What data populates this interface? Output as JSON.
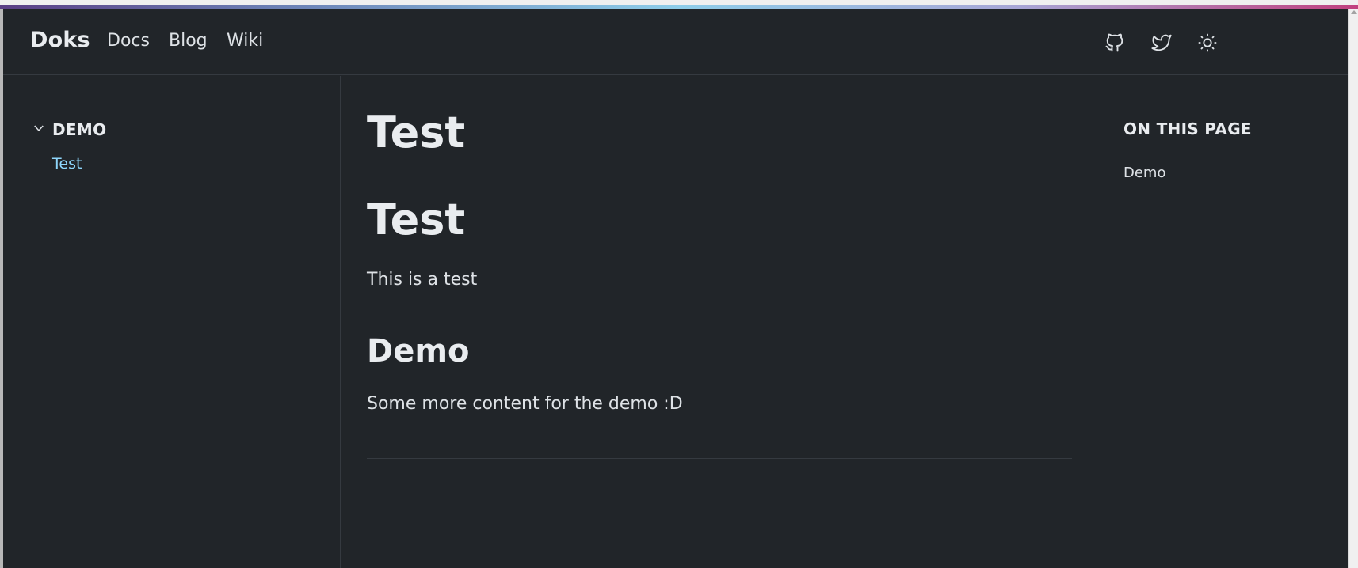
{
  "navbar": {
    "brand": "Doks",
    "links": [
      "Docs",
      "Blog",
      "Wiki"
    ],
    "icons": [
      "github-icon",
      "twitter-icon",
      "sun-icon"
    ]
  },
  "sidebar": {
    "section_title": "DEMO",
    "items": [
      "Test"
    ]
  },
  "content": {
    "title": "Test",
    "heading": "Test",
    "paragraph1": "This is a test",
    "subheading": "Demo",
    "paragraph2": "Some more content for the demo :D"
  },
  "toc": {
    "title": "ON THIS PAGE",
    "items": [
      "Demo"
    ]
  },
  "colors": {
    "background": "#212529",
    "text": "#dee2e6",
    "link_active": "#8ed6fb",
    "border": "#353a40"
  }
}
